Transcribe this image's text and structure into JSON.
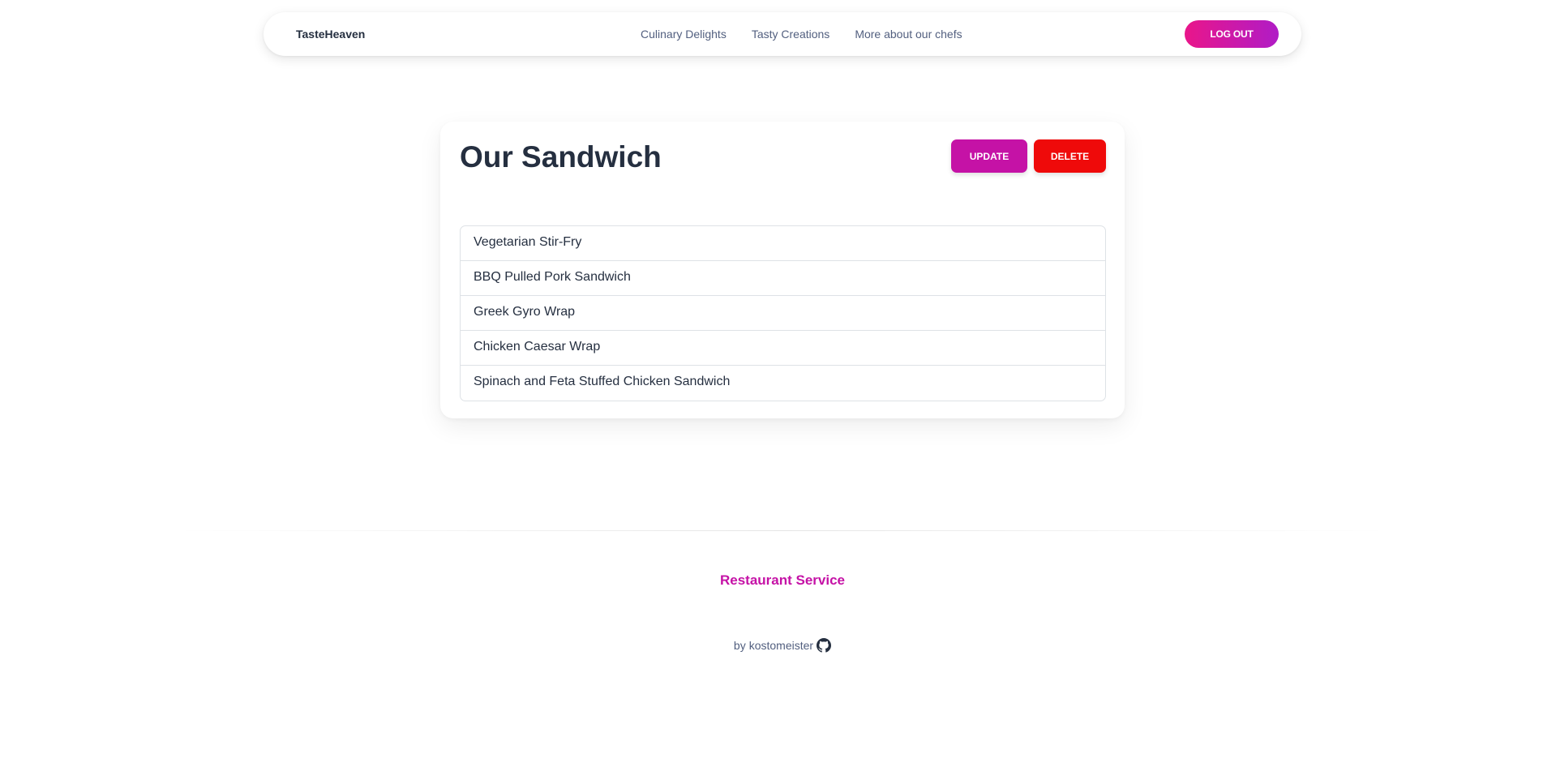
{
  "navbar": {
    "brand": "TasteHeaven",
    "links": [
      {
        "label": "Culinary Delights"
      },
      {
        "label": "Tasty Creations"
      },
      {
        "label": "More about our chefs"
      }
    ],
    "logout_label": "LOG OUT",
    "logout_gradient": [
      "#e9168a",
      "#b01cc6"
    ]
  },
  "card": {
    "title": "Our Sandwich",
    "update_label": "UPDATE",
    "delete_label": "DELETE",
    "update_color": "#c512a6",
    "delete_color": "#ef0a0a",
    "items": [
      {
        "label": "Vegetarian Stir-Fry"
      },
      {
        "label": "BBQ Pulled Pork Sandwich"
      },
      {
        "label": "Greek Gyro Wrap"
      },
      {
        "label": "Chicken Caesar Wrap"
      },
      {
        "label": "Spinach and Feta Stuffed Chicken Sandwich"
      }
    ]
  },
  "footer": {
    "title": "Restaurant Service",
    "credit_prefix": "by",
    "author": "kostomeister",
    "author_icon": "github-icon",
    "title_color": "#c512a6"
  }
}
